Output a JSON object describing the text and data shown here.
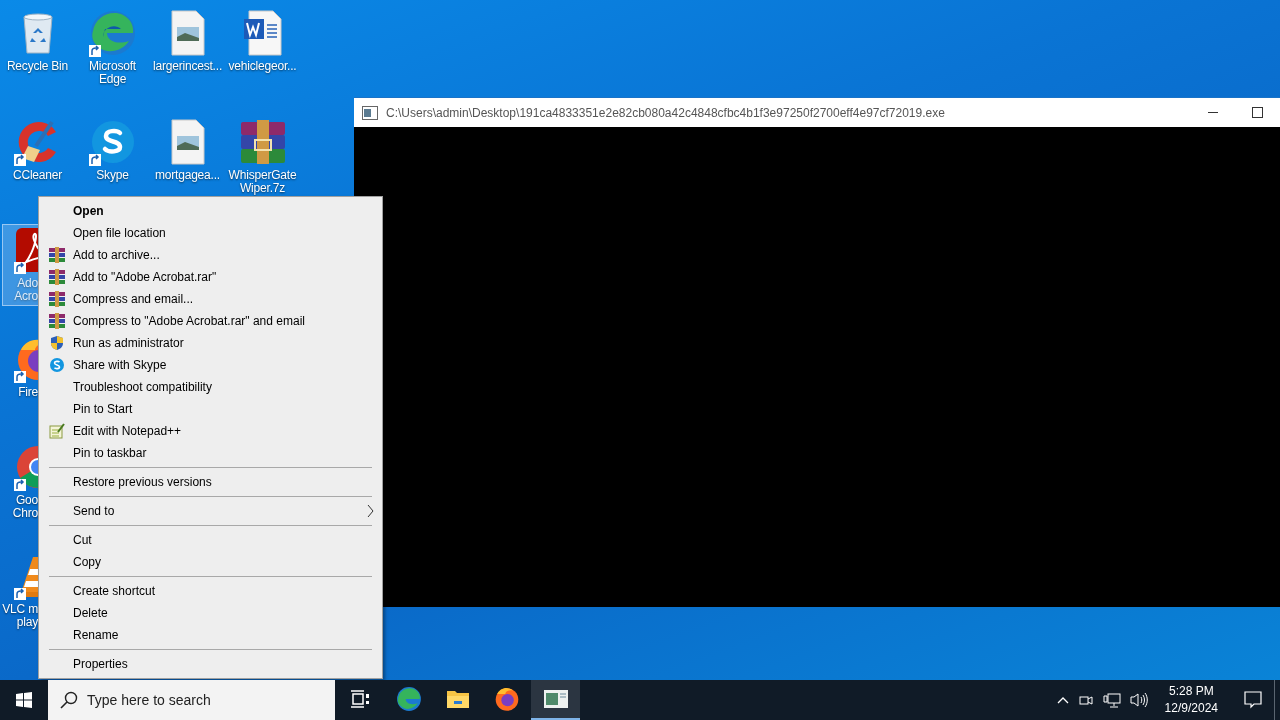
{
  "desktop_icons": [
    {
      "kind": "recycle-bin",
      "label": [
        "Recycle Bin"
      ],
      "shortcut": false,
      "selected": false
    },
    {
      "kind": "edge",
      "label": [
        "Microsoft",
        "Edge"
      ],
      "shortcut": true,
      "selected": false
    },
    {
      "kind": "image-file",
      "label": [
        "largerincest..."
      ],
      "shortcut": false,
      "selected": false
    },
    {
      "kind": "word-file",
      "label": [
        "vehiclegeor..."
      ],
      "shortcut": false,
      "selected": false
    },
    {
      "kind": "ccleaner",
      "label": [
        "CCleaner"
      ],
      "shortcut": true,
      "selected": false
    },
    {
      "kind": "skype",
      "label": [
        "Skype"
      ],
      "shortcut": true,
      "selected": false
    },
    {
      "kind": "image-file",
      "label": [
        "mortgagea..."
      ],
      "shortcut": false,
      "selected": false
    },
    {
      "kind": "winrar",
      "label": [
        "WhisperGate",
        "Wiper.7z"
      ],
      "shortcut": false,
      "selected": false
    },
    {
      "kind": "acrobat",
      "label": [
        "Ado",
        "Acro"
      ],
      "shortcut": true,
      "selected": true
    },
    {
      "kind": "firefox",
      "label": [
        "Fire"
      ],
      "shortcut": true,
      "selected": false
    },
    {
      "kind": "chrome",
      "label": [
        "Goo",
        "Chro"
      ],
      "shortcut": true,
      "selected": false
    },
    {
      "kind": "vlc",
      "label": [
        "VLC m",
        "play"
      ],
      "shortcut": true,
      "selected": false
    }
  ],
  "console_window": {
    "title": "C:\\Users\\admin\\Desktop\\191ca4833351e2e82cb080a42c4848cfbc4b1f3e97250f2700eff4e97cf72019.exe"
  },
  "context_menu": [
    {
      "kind": "plain",
      "label": "Open",
      "default": true
    },
    {
      "kind": "plain",
      "label": "Open file location",
      "default": false
    },
    {
      "kind": "winrar",
      "label": "Add to archive...",
      "default": false
    },
    {
      "kind": "winrar",
      "label": "Add to \"Adobe Acrobat.rar\"",
      "default": false
    },
    {
      "kind": "winrar",
      "label": "Compress and email...",
      "default": false
    },
    {
      "kind": "winrar",
      "label": "Compress to \"Adobe Acrobat.rar\" and email",
      "default": false
    },
    {
      "kind": "shield",
      "label": "Run as administrator",
      "default": false
    },
    {
      "kind": "skype",
      "label": "Share with Skype",
      "default": false
    },
    {
      "kind": "plain",
      "label": "Troubleshoot compatibility",
      "default": false
    },
    {
      "kind": "plain",
      "label": "Pin to Start",
      "default": false
    },
    {
      "kind": "notepad",
      "label": "Edit with Notepad++",
      "default": false
    },
    {
      "kind": "plain",
      "label": "Pin to taskbar",
      "default": false
    },
    {
      "kind": "separator"
    },
    {
      "kind": "plain",
      "label": "Restore previous versions",
      "default": false
    },
    {
      "kind": "separator"
    },
    {
      "kind": "submenu",
      "label": "Send to",
      "default": false
    },
    {
      "kind": "separator"
    },
    {
      "kind": "plain",
      "label": "Cut",
      "default": false
    },
    {
      "kind": "plain",
      "label": "Copy",
      "default": false
    },
    {
      "kind": "separator"
    },
    {
      "kind": "plain",
      "label": "Create shortcut",
      "default": false
    },
    {
      "kind": "plain",
      "label": "Delete",
      "default": false
    },
    {
      "kind": "plain",
      "label": "Rename",
      "default": false
    },
    {
      "kind": "separator"
    },
    {
      "kind": "plain",
      "label": "Properties",
      "default": false
    }
  ],
  "taskbar": {
    "search": {
      "placeholder": "Type here to search"
    },
    "apps": [
      {
        "kind": "task-view",
        "active": false
      },
      {
        "kind": "edge",
        "active": false
      },
      {
        "kind": "explorer",
        "active": false
      },
      {
        "kind": "firefox",
        "active": false
      },
      {
        "kind": "console",
        "active": true
      }
    ],
    "clock": {
      "time": "5:28 PM",
      "date": "12/9/2024"
    }
  }
}
